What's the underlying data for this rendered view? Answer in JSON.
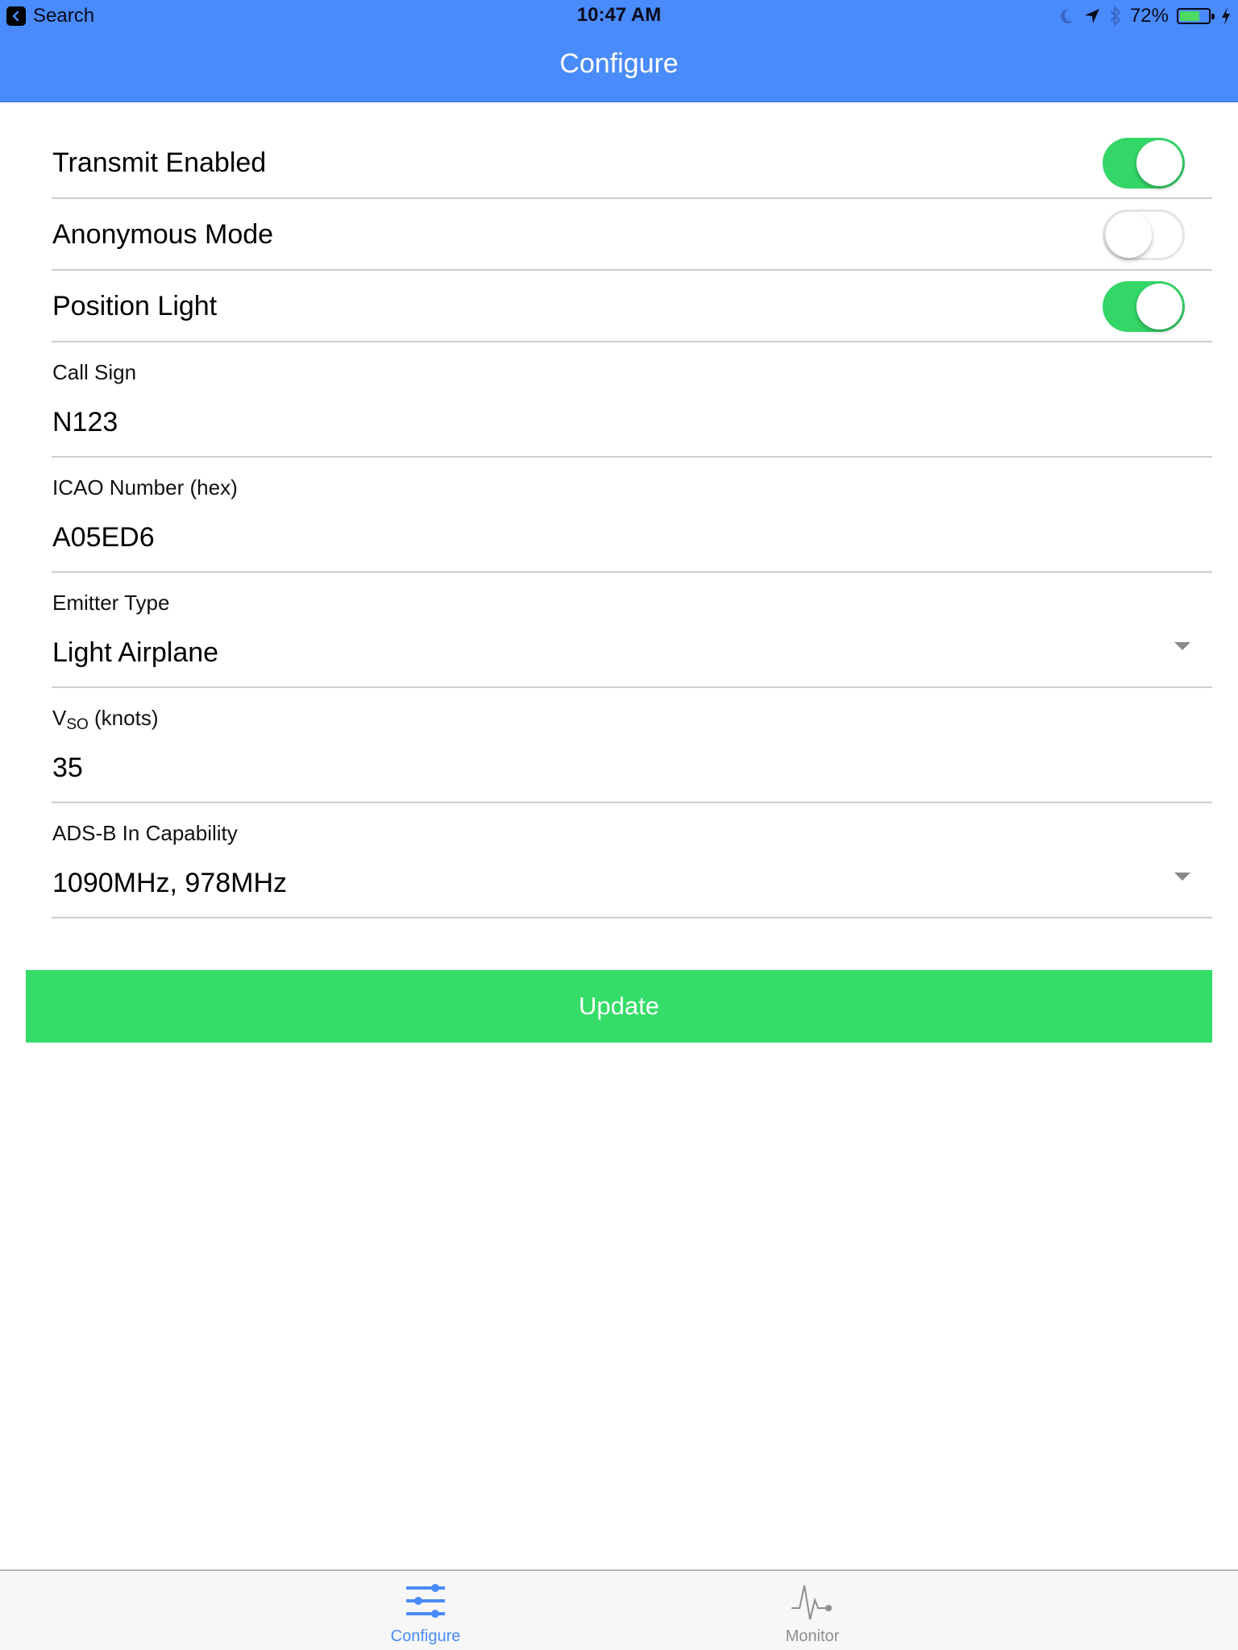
{
  "status_bar": {
    "back_app_label": "Search",
    "time": "10:47 AM",
    "battery_percent_label": "72%",
    "battery_level": 0.72,
    "icons": [
      "moon-icon",
      "location-arrow-icon",
      "bluetooth-icon",
      "battery-icon",
      "charging-bolt-icon"
    ]
  },
  "nav": {
    "title": "Configure"
  },
  "colors": {
    "header": "#4a8bfc",
    "toggle_on": "#34d667",
    "update_button": "#34dc68",
    "tab_active": "#4a8bfc",
    "tab_inactive": "#8e8e8e"
  },
  "toggles": [
    {
      "label": "Transmit Enabled",
      "on": true
    },
    {
      "label": "Anonymous Mode",
      "on": false
    },
    {
      "label": "Position Light",
      "on": true
    }
  ],
  "fields": {
    "call_sign": {
      "label": "Call Sign",
      "value": "N123"
    },
    "icao": {
      "label": "ICAO Number (hex)",
      "value": "A05ED6"
    },
    "emitter_type": {
      "label": "Emitter Type",
      "value": "Light Airplane"
    },
    "vso": {
      "label_main": "V",
      "label_sub": "SO",
      "label_rest": " (knots)",
      "value": "35"
    },
    "adsb_in": {
      "label": "ADS-B In Capability",
      "value": "1090MHz, 978MHz"
    }
  },
  "update_button": {
    "label": "Update"
  },
  "tabs": [
    {
      "label": "Configure",
      "icon": "sliders-icon",
      "active": true
    },
    {
      "label": "Monitor",
      "icon": "pulse-icon",
      "active": false
    }
  ]
}
